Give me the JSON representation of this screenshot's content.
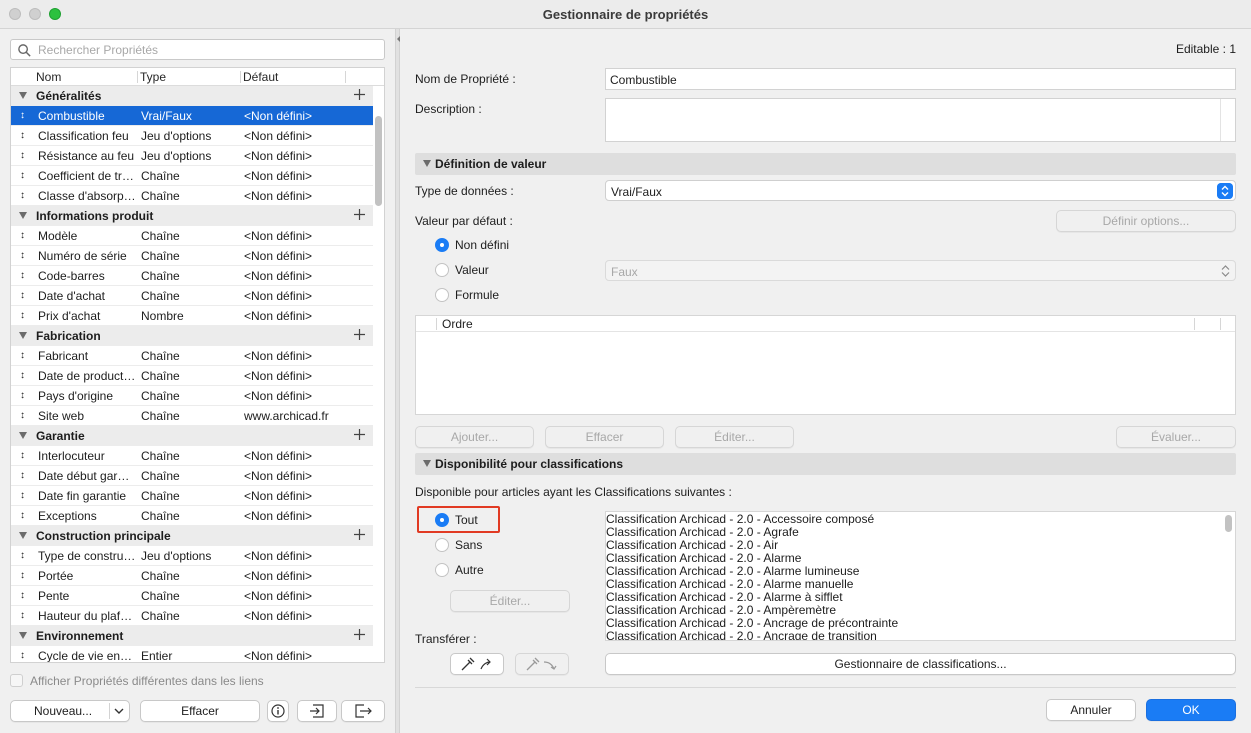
{
  "window": {
    "title": "Gestionnaire de propriétés"
  },
  "left": {
    "search_placeholder": "Rechercher Propriétés",
    "columns": [
      "Nom",
      "Type",
      "Défaut"
    ],
    "groups": [
      {
        "name": "Généralités",
        "rows": [
          {
            "name": "Combustible",
            "type": "Vrai/Faux",
            "default": "<Non défini>",
            "selected": true
          },
          {
            "name": "Classification feu",
            "type": "Jeu d'options",
            "default": "<Non défini>"
          },
          {
            "name": "Résistance au feu",
            "type": "Jeu d'options",
            "default": "<Non défini>"
          },
          {
            "name": "Coefficient de tra...",
            "type": "Chaîne",
            "default": "<Non défini>"
          },
          {
            "name": "Classe d'absorpti...",
            "type": "Chaîne",
            "default": "<Non défini>"
          }
        ]
      },
      {
        "name": "Informations produit",
        "rows": [
          {
            "name": "Modèle",
            "type": "Chaîne",
            "default": "<Non défini>"
          },
          {
            "name": "Numéro de série",
            "type": "Chaîne",
            "default": "<Non défini>"
          },
          {
            "name": "Code-barres",
            "type": "Chaîne",
            "default": "<Non défini>"
          },
          {
            "name": "Date d'achat",
            "type": "Chaîne",
            "default": "<Non défini>"
          },
          {
            "name": "Prix d'achat",
            "type": "Nombre",
            "default": "<Non défini>"
          }
        ]
      },
      {
        "name": "Fabrication",
        "rows": [
          {
            "name": "Fabricant",
            "type": "Chaîne",
            "default": "<Non défini>"
          },
          {
            "name": "Date de production",
            "type": "Chaîne",
            "default": "<Non défini>"
          },
          {
            "name": "Pays d'origine",
            "type": "Chaîne",
            "default": "<Non défini>"
          },
          {
            "name": "Site web",
            "type": "Chaîne",
            "default": "www.archicad.fr"
          }
        ]
      },
      {
        "name": "Garantie",
        "rows": [
          {
            "name": "Interlocuteur",
            "type": "Chaîne",
            "default": "<Non défini>"
          },
          {
            "name": "Date début garan...",
            "type": "Chaîne",
            "default": "<Non défini>"
          },
          {
            "name": "Date fin garantie",
            "type": "Chaîne",
            "default": "<Non défini>"
          },
          {
            "name": "Exceptions",
            "type": "Chaîne",
            "default": "<Non défini>"
          }
        ]
      },
      {
        "name": "Construction principale",
        "rows": [
          {
            "name": "Type de construc...",
            "type": "Jeu d'options",
            "default": "<Non défini>"
          },
          {
            "name": "Portée",
            "type": "Chaîne",
            "default": "<Non défini>"
          },
          {
            "name": "Pente",
            "type": "Chaîne",
            "default": "<Non défini>"
          },
          {
            "name": "Hauteur du plafond",
            "type": "Chaîne",
            "default": "<Non défini>"
          }
        ]
      },
      {
        "name": "Environnement",
        "rows": [
          {
            "name": "Cycle de vie envir...",
            "type": "Entier",
            "default": "<Non défini>"
          }
        ]
      }
    ],
    "show_diff_label": "Afficher Propriétés différentes dans les liens",
    "new_button": "Nouveau...",
    "delete_button": "Effacer"
  },
  "right": {
    "editable_label": "Editable : 1",
    "property_name_label": "Nom de Propriété :",
    "property_name_value": "Combustible",
    "description_label": "Description :",
    "value_def_section": "Définition de valeur",
    "data_type_label": "Type de données :",
    "data_type_value": "Vrai/Faux",
    "default_value_label": "Valeur par défaut :",
    "define_options_button": "Définir options...",
    "radio_undefined": "Non défini",
    "radio_value": "Valeur",
    "value_select": "Faux",
    "radio_formula": "Formule",
    "order_header": "Ordre",
    "add_button": "Ajouter...",
    "clear_button": "Effacer",
    "edit_button": "Éditer...",
    "evaluate_button": "Évaluer...",
    "availability_section": "Disponibilité pour classifications",
    "availability_desc": "Disponible pour articles ayant les Classifications suivantes :",
    "radio_all": "Tout",
    "radio_none": "Sans",
    "radio_other": "Autre",
    "edit2_button": "Éditer...",
    "classifications": [
      "Classification Archicad - 2.0 - Accessoire composé",
      "Classification Archicad - 2.0 - Agrafe",
      "Classification Archicad - 2.0 - Air",
      "Classification Archicad - 2.0 - Alarme",
      "Classification Archicad - 2.0 - Alarme lumineuse",
      "Classification Archicad - 2.0 - Alarme manuelle",
      "Classification Archicad - 2.0 - Alarme à sifflet",
      "Classification Archicad - 2.0 - Ampèremètre",
      "Classification Archicad - 2.0 - Ancrage de précontrainte",
      "Classification Archicad - 2.0 - Ancrage de transition"
    ],
    "transfer_label": "Transférer :",
    "classif_manager_button": "Gestionnaire de classifications...",
    "cancel_button": "Annuler",
    "ok_button": "OK"
  }
}
